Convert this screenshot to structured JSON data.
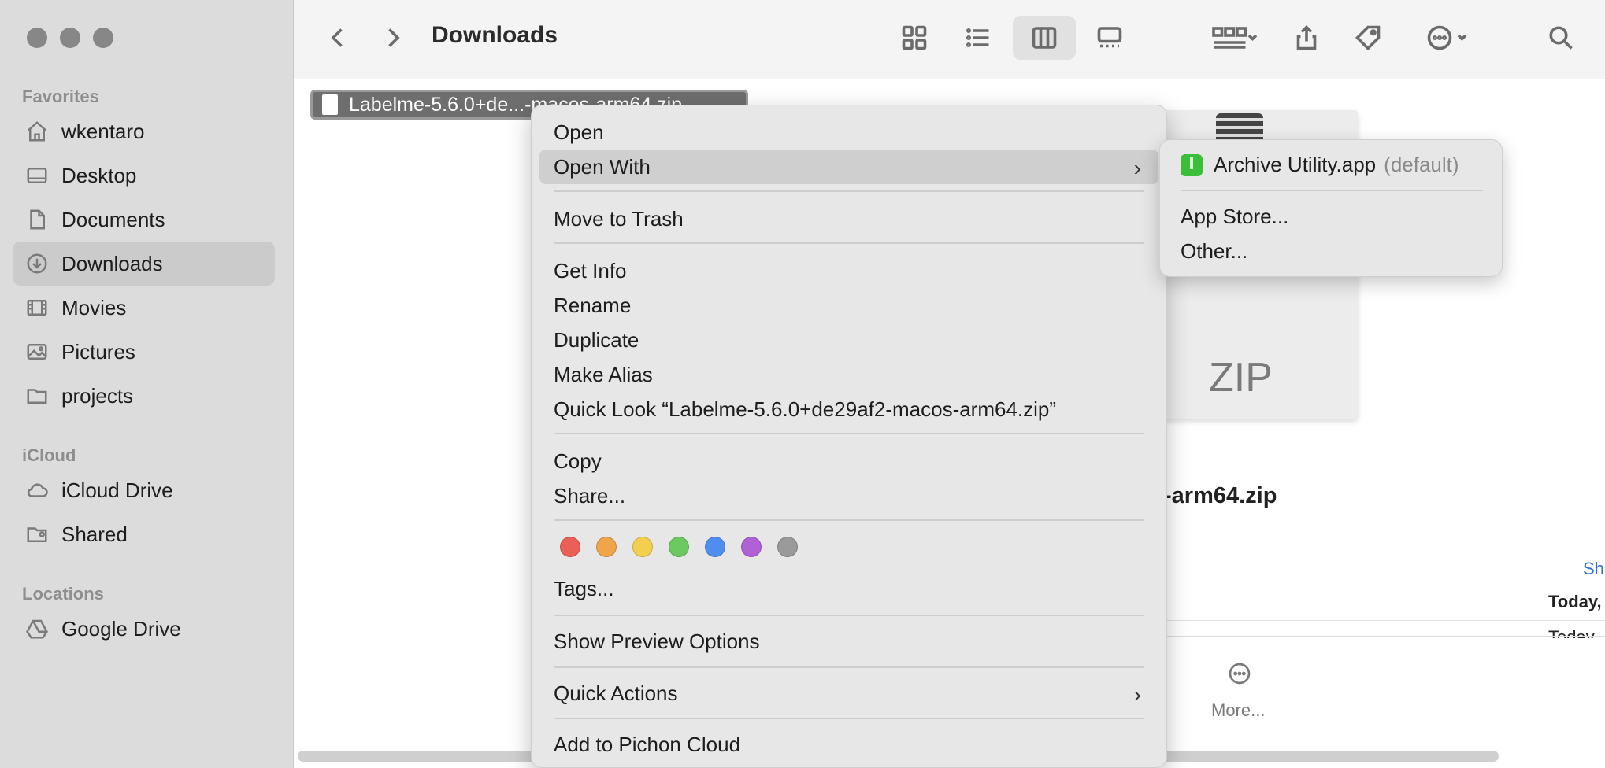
{
  "sidebar": {
    "favorites_label": "Favorites",
    "icloud_label": "iCloud",
    "locations_label": "Locations",
    "favorites": [
      {
        "label": "wkentaro",
        "icon": "home-icon"
      },
      {
        "label": "Desktop",
        "icon": "desktop-icon"
      },
      {
        "label": "Documents",
        "icon": "document-icon"
      },
      {
        "label": "Downloads",
        "icon": "download-icon"
      },
      {
        "label": "Movies",
        "icon": "film-icon"
      },
      {
        "label": "Pictures",
        "icon": "photo-icon"
      },
      {
        "label": "projects",
        "icon": "folder-icon"
      }
    ],
    "icloud": [
      {
        "label": "iCloud Drive",
        "icon": "cloud-icon"
      },
      {
        "label": "Shared",
        "icon": "shared-folder-icon"
      }
    ],
    "locations": [
      {
        "label": "Google Drive",
        "icon": "google-drive-icon"
      }
    ]
  },
  "toolbar": {
    "title": "Downloads"
  },
  "file": {
    "name": "Labelme-5.6.0+de...-macos-arm64.zip"
  },
  "preview": {
    "type_label": "ZIP",
    "name_fragment": "-arm64.zip",
    "link_fragment": "Sh",
    "date_fragment": "Today,",
    "date_fragment2": "Today",
    "more_label": "More..."
  },
  "context_menu": {
    "open": "Open",
    "open_with": "Open With",
    "move_to_trash": "Move to Trash",
    "get_info": "Get Info",
    "rename": "Rename",
    "duplicate": "Duplicate",
    "make_alias": "Make Alias",
    "quick_look": "Quick Look “Labelme-5.6.0+de29af2-macos-arm64.zip”",
    "copy": "Copy",
    "share": "Share...",
    "tags": "Tags...",
    "show_preview_options": "Show Preview Options",
    "quick_actions": "Quick Actions",
    "add_to_pichon_cloud": "Add to Pichon Cloud",
    "tag_colors": [
      "#ec5f58",
      "#f0a54a",
      "#f4cf4f",
      "#6cc962",
      "#4f8ef0",
      "#b061d6",
      "#9a9a9a"
    ]
  },
  "submenu": {
    "archive_utility": "Archive Utility.app",
    "default_label": "(default)",
    "app_store": "App Store...",
    "other": "Other..."
  }
}
